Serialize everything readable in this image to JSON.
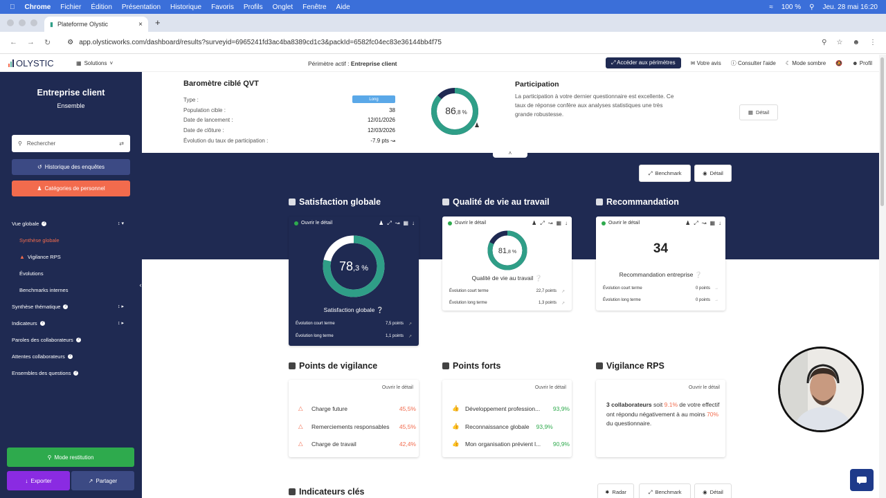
{
  "macbar": {
    "app": "Chrome",
    "menus": [
      "Fichier",
      "Édition",
      "Présentation",
      "Historique",
      "Favoris",
      "Profils",
      "Onglet",
      "Fenêtre",
      "Aide"
    ],
    "battery": "100 %",
    "datetime": "Jeu. 28 mai  16:20"
  },
  "browser": {
    "tab_title": "Plateforme Olystic",
    "url": "app.olysticworks.com/dashboard/results?surveyid=6965241fd3ac4ba8389cd1c3&packId=6582fc04ec83e36144bb4f75"
  },
  "appbar": {
    "logo": "OLYSTIC",
    "solutions": "Solutions",
    "perimetre_label": "Périmètre actif :",
    "perimetre_value": "Entreprise client",
    "acceder": "Accéder aux périmètres",
    "avis": "Votre avis",
    "aide": "Consulter l'aide",
    "sombre": "Mode sombre",
    "profil": "Profil"
  },
  "sidebar": {
    "entity": "Entreprise client",
    "subtitle": "Ensemble",
    "search_placeholder": "Rechercher",
    "historique": "Historique des enquêtes",
    "categories": "Catégories de personnel",
    "items": {
      "vue": "Vue globale",
      "synthese": "Synthèse globale",
      "vigilance": "Vigilance RPS",
      "evolutions": "Évolutions",
      "benchmarks": "Benchmarks internes",
      "thematique": "Synthèse thématique",
      "indicateurs": "Indicateurs",
      "paroles": "Paroles des collaborateurs",
      "attentes": "Attentes collaborateurs",
      "ensembles": "Ensembles des questions"
    },
    "restitution": "Mode restitution",
    "exporter": "Exporter",
    "partager": "Partager"
  },
  "survey": {
    "title": "Baromètre ciblé QVT",
    "tag": "Long",
    "labels": {
      "type": "Type :",
      "population": "Population cible :",
      "lancement": "Date de lancement :",
      "cloture": "Date de clôture :",
      "evolution": "Évolution du taux de participation :"
    },
    "values": {
      "population": "38",
      "lancement": "12/01/2026",
      "cloture": "12/03/2026",
      "evolution": "-7.9 pts"
    },
    "participation_int": "86",
    "participation_dec": ",8 %",
    "participation_value": 86.8,
    "participation_title": "Participation",
    "participation_text": "La participation à votre dernier questionnaire est excellente. Ce taux de réponse confère aux analyses statistiques une très grande robustesse.",
    "detail": "Détail"
  },
  "toolbar": {
    "benchmark": "Benchmark",
    "detail": "Détail",
    "radar": "Radar"
  },
  "cards": {
    "open": "Ouvrir le détail",
    "ect": "Évolution court terme",
    "elt": "Évolution long terme",
    "satisfaction": {
      "title": "Satisfaction globale",
      "int": "78",
      "dec": ",3 %",
      "value": 78.3,
      "label": "Satisfaction globale",
      "ct": "7,5 points",
      "lt": "1,1 points"
    },
    "qvt": {
      "title": "Qualité de vie au travail",
      "int": "81",
      "dec": ",8 %",
      "value": 81.8,
      "label": "Qualité de vie au travail",
      "ct": "22,7 points",
      "lt": "1,3 points"
    },
    "reco": {
      "title": "Recommandation",
      "value": "34",
      "label": "Recommandation entreprise",
      "ct": "0 points",
      "lt": "0 points"
    }
  },
  "vigilance": {
    "title": "Points de vigilance",
    "items": [
      {
        "label": "Charge future",
        "value": "45,5%"
      },
      {
        "label": "Remerciements responsables",
        "value": "45,5%"
      },
      {
        "label": "Charge de travail",
        "value": "42,4%"
      }
    ]
  },
  "forts": {
    "title": "Points forts",
    "items": [
      {
        "label": "Développement profession...",
        "value": "93,9%"
      },
      {
        "label": "Reconnaissance globale",
        "value": "93,9%"
      },
      {
        "label": "Mon organisation prévient l...",
        "value": "90,9%"
      }
    ]
  },
  "rps": {
    "title": "Vigilance RPS",
    "count": "3 collaborateurs",
    "t1": " soit ",
    "pct": "9.1%",
    "t2": " de votre effectif ont répondu négativement à au moins ",
    "pct2": "70%",
    "t3": " du questionnaire."
  },
  "indicateurs": {
    "title": "Indicateurs clés"
  },
  "colors": {
    "navy": "#1f2a52",
    "teal": "#2f9e87",
    "orange": "#f26b4d",
    "green": "#2eaa4d"
  }
}
